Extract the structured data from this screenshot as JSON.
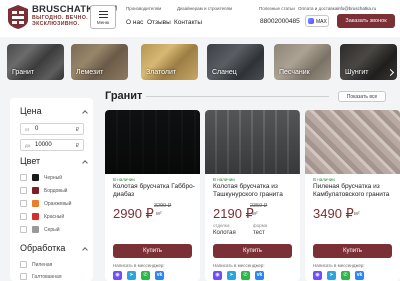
{
  "header": {
    "logo_name": "BRUSCHATKA.RU",
    "logo_slogan": "ВЫГОДНО. ВЕЧНО. ЭКСКЛЮЗИВНО.",
    "menu_label": "Меню",
    "top_links": [
      "Производителям",
      "Дизайнерам и строителям",
      "Полезные статьи",
      "Оплата и доставка"
    ],
    "email": "info@bruschatka.ru",
    "nav": [
      "О нас",
      "Отзывы",
      "Контакты"
    ],
    "phone": "88002000485",
    "max_label": "MAX",
    "call_button": "Заказать звонок"
  },
  "categories": [
    "Гранит",
    "Лемезит",
    "Златолит",
    "Сланец",
    "Песчаник",
    "Шунгит"
  ],
  "filters": {
    "price": {
      "title": "Цена",
      "from_prefix": "от",
      "from_value": "0",
      "to_prefix": "до",
      "to_value": "10000",
      "currency": "₽"
    },
    "color": {
      "title": "Цвет",
      "options": [
        {
          "label": "Черный",
          "color": "#1a1a1a"
        },
        {
          "label": "Бордовый",
          "color": "#7a1f24"
        },
        {
          "label": "Оранжевый",
          "color": "#e87d2a"
        },
        {
          "label": "Красный",
          "color": "#d62d2d"
        },
        {
          "label": "Серый",
          "color": "#9a9a9a"
        }
      ]
    },
    "treatment": {
      "title": "Обработка",
      "options": [
        "Пиленая",
        "Галтованная"
      ]
    }
  },
  "main": {
    "title": "Гранит",
    "show_all": "Показать все"
  },
  "products": [
    {
      "stock": "В наличии",
      "name": "Колотая брусчатка Габбро-диабаз",
      "price": "2990 ₽",
      "old_price": "3299 ₽",
      "unit": "м²",
      "specs": [],
      "buy": "Купить",
      "messenger": "Написать в мессенджер:"
    },
    {
      "stock": "В наличии",
      "name": "Колотая брусчатка из Ташкунурского гранита",
      "price": "2190 ₽",
      "old_price": "2350 ₽",
      "unit": "м²",
      "specs": [
        {
          "label": "отделка",
          "value": "Колотая"
        },
        {
          "label": "форма",
          "value": "тест"
        }
      ],
      "buy": "Купить",
      "messenger": "Написать в мессенджер:"
    },
    {
      "stock": "В наличии",
      "name": "Пиленая брусчатка из Камбулатовского гранита",
      "price": "3490 ₽",
      "old_price": "",
      "unit": "м²",
      "specs": [],
      "buy": "Купить",
      "messenger": "Написать в мессенджер:"
    }
  ],
  "icons": {
    "social": [
      "max-icon",
      "telegram-icon",
      "whatsapp-icon",
      "vk-icon"
    ],
    "social_colors": [
      "#6f4cff",
      "#2aa5e0",
      "#2ab84a",
      "#2787f5"
    ],
    "social_glyphs": [
      "◉",
      "➤",
      "✆",
      "vk"
    ]
  },
  "colors": {
    "brand": "#7a3035",
    "in_stock": "#2f8a3b",
    "page_bg": "#f3f4f6"
  }
}
